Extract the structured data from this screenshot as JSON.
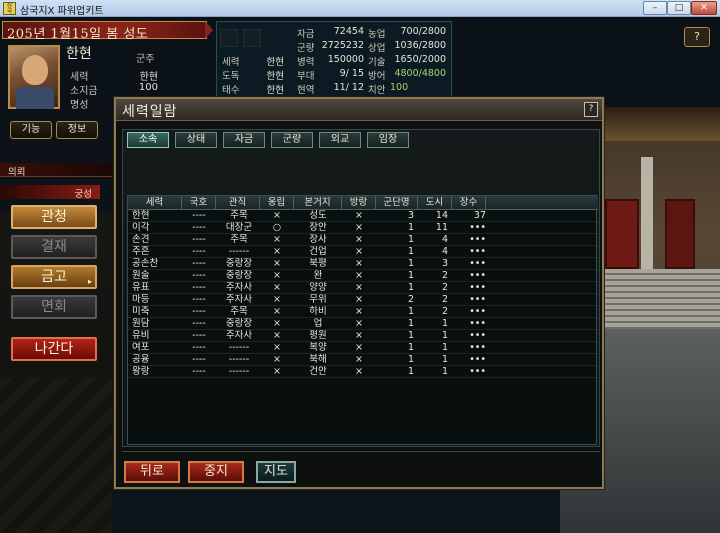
{
  "window": {
    "title": "삼국지X 파워업키트",
    "app_icon_text": "삼국지X",
    "min": "–",
    "max": "□",
    "close": "✕"
  },
  "top": {
    "date": "205년 1월15일 봄 성도",
    "ruler_name": "한현",
    "help": "?"
  },
  "profile": {
    "role_label": "군주",
    "rows": [
      {
        "label": "세력",
        "value": "한현"
      },
      {
        "label": "소지금",
        "value": "100"
      },
      {
        "label": "명성",
        "value": ""
      }
    ]
  },
  "stats": {
    "left_rows": [
      {
        "label": "세력",
        "value": "한현"
      },
      {
        "label": "도독",
        "value": "한현"
      },
      {
        "label": "태수",
        "value": "한현"
      }
    ],
    "grid": [
      {
        "label": "자금",
        "value": "72454",
        "label2": "농업",
        "value2": "700/2800"
      },
      {
        "label": "군량",
        "value": "2725232",
        "label2": "상업",
        "value2": "1036/2800"
      },
      {
        "label": "병력",
        "value": "150000",
        "label2": "기술",
        "value2": "1650/2000"
      },
      {
        "label": "부대",
        "value": "9/ 15",
        "label2": "방어",
        "value2": "4800/4800"
      },
      {
        "label": "현역",
        "value": "11/ 12",
        "label2": "치안",
        "value2": "100"
      }
    ]
  },
  "side_tabs": {
    "function": "기능",
    "info": "정보"
  },
  "side": {
    "strip_label": "의뢰",
    "palace_label": "궁성",
    "menu": [
      {
        "label": "관청"
      },
      {
        "label": "결재"
      },
      {
        "label": "금고"
      },
      {
        "label": "면회"
      },
      {
        "label": "나간다"
      }
    ]
  },
  "dialog": {
    "title": "세력일람",
    "help": "?",
    "tabs": [
      "소속",
      "상태",
      "자금",
      "군량",
      "외교",
      "임장"
    ],
    "columns": [
      "세력",
      "국호",
      "관직",
      "옹립",
      "본거지",
      "방랑",
      "군단명",
      "도시",
      "장수"
    ],
    "rows": [
      [
        "한현",
        "----",
        "주목",
        "×",
        "성도",
        "×",
        "3",
        "14",
        "37"
      ],
      [
        "이각",
        "----",
        "대장군",
        "○",
        "장안",
        "×",
        "1",
        "11",
        "•••"
      ],
      [
        "손견",
        "----",
        "주목",
        "×",
        "장사",
        "×",
        "1",
        "4",
        "•••"
      ],
      [
        "주흔",
        "----",
        "------",
        "×",
        "건업",
        "×",
        "1",
        "4",
        "•••"
      ],
      [
        "공손찬",
        "----",
        "중랑장",
        "×",
        "북평",
        "×",
        "1",
        "3",
        "•••"
      ],
      [
        "원술",
        "----",
        "중랑장",
        "×",
        "완",
        "×",
        "1",
        "2",
        "•••"
      ],
      [
        "유표",
        "----",
        "주자사",
        "×",
        "양양",
        "×",
        "1",
        "2",
        "•••"
      ],
      [
        "마등",
        "----",
        "주자사",
        "×",
        "무위",
        "×",
        "2",
        "2",
        "•••"
      ],
      [
        "미축",
        "----",
        "주목",
        "×",
        "하비",
        "×",
        "1",
        "2",
        "•••"
      ],
      [
        "원담",
        "----",
        "중랑장",
        "×",
        "업",
        "×",
        "1",
        "1",
        "•••"
      ],
      [
        "유비",
        "----",
        "주자사",
        "×",
        "평원",
        "×",
        "1",
        "1",
        "•••"
      ],
      [
        "여포",
        "----",
        "------",
        "×",
        "복양",
        "×",
        "1",
        "1",
        "•••"
      ],
      [
        "공융",
        "----",
        "------",
        "×",
        "북해",
        "×",
        "1",
        "1",
        "•••"
      ],
      [
        "왕랑",
        "----",
        "------",
        "×",
        "건안",
        "×",
        "1",
        "1",
        "•••"
      ]
    ],
    "buttons": {
      "back": "뒤로",
      "stop": "중지",
      "map": "지도"
    }
  }
}
